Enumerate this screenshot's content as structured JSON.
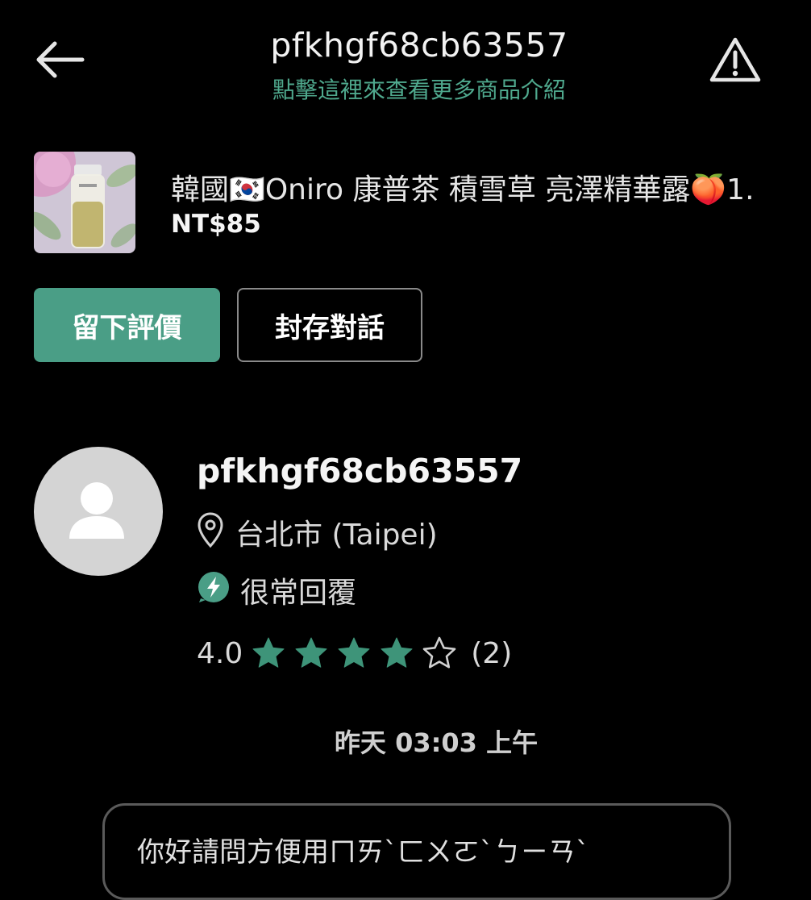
{
  "header": {
    "title": "pfkhgf68cb63557",
    "subtitle": "點擊這裡來查看更多商品介紹",
    "back_icon": "arrow-left-icon",
    "report_icon": "warning-triangle-icon"
  },
  "product": {
    "title": "韓國🇰🇷Oniro 康普茶 積雪草 亮澤精華露🍑1.",
    "price": "NT$85"
  },
  "actions": {
    "review_label": "留下評價",
    "archive_label": "封存對話"
  },
  "profile": {
    "name": "pfkhgf68cb63557",
    "location": "台北市 (Taipei)",
    "reply_badge": "很常回覆",
    "rating_value": "4.0",
    "rating_stars": 4,
    "rating_max": 5,
    "rating_count": "(2)"
  },
  "chat": {
    "timestamp": "昨天 03:03 上午",
    "message_preview": "你好請問方便用ㄇㄞˋㄈㄨㄛˋㄅㄧㄢˋ"
  },
  "colors": {
    "background": "#000000",
    "accent": "#4a9e86",
    "subtitle_green": "#4fa88d",
    "star_green": "#3e9479"
  }
}
